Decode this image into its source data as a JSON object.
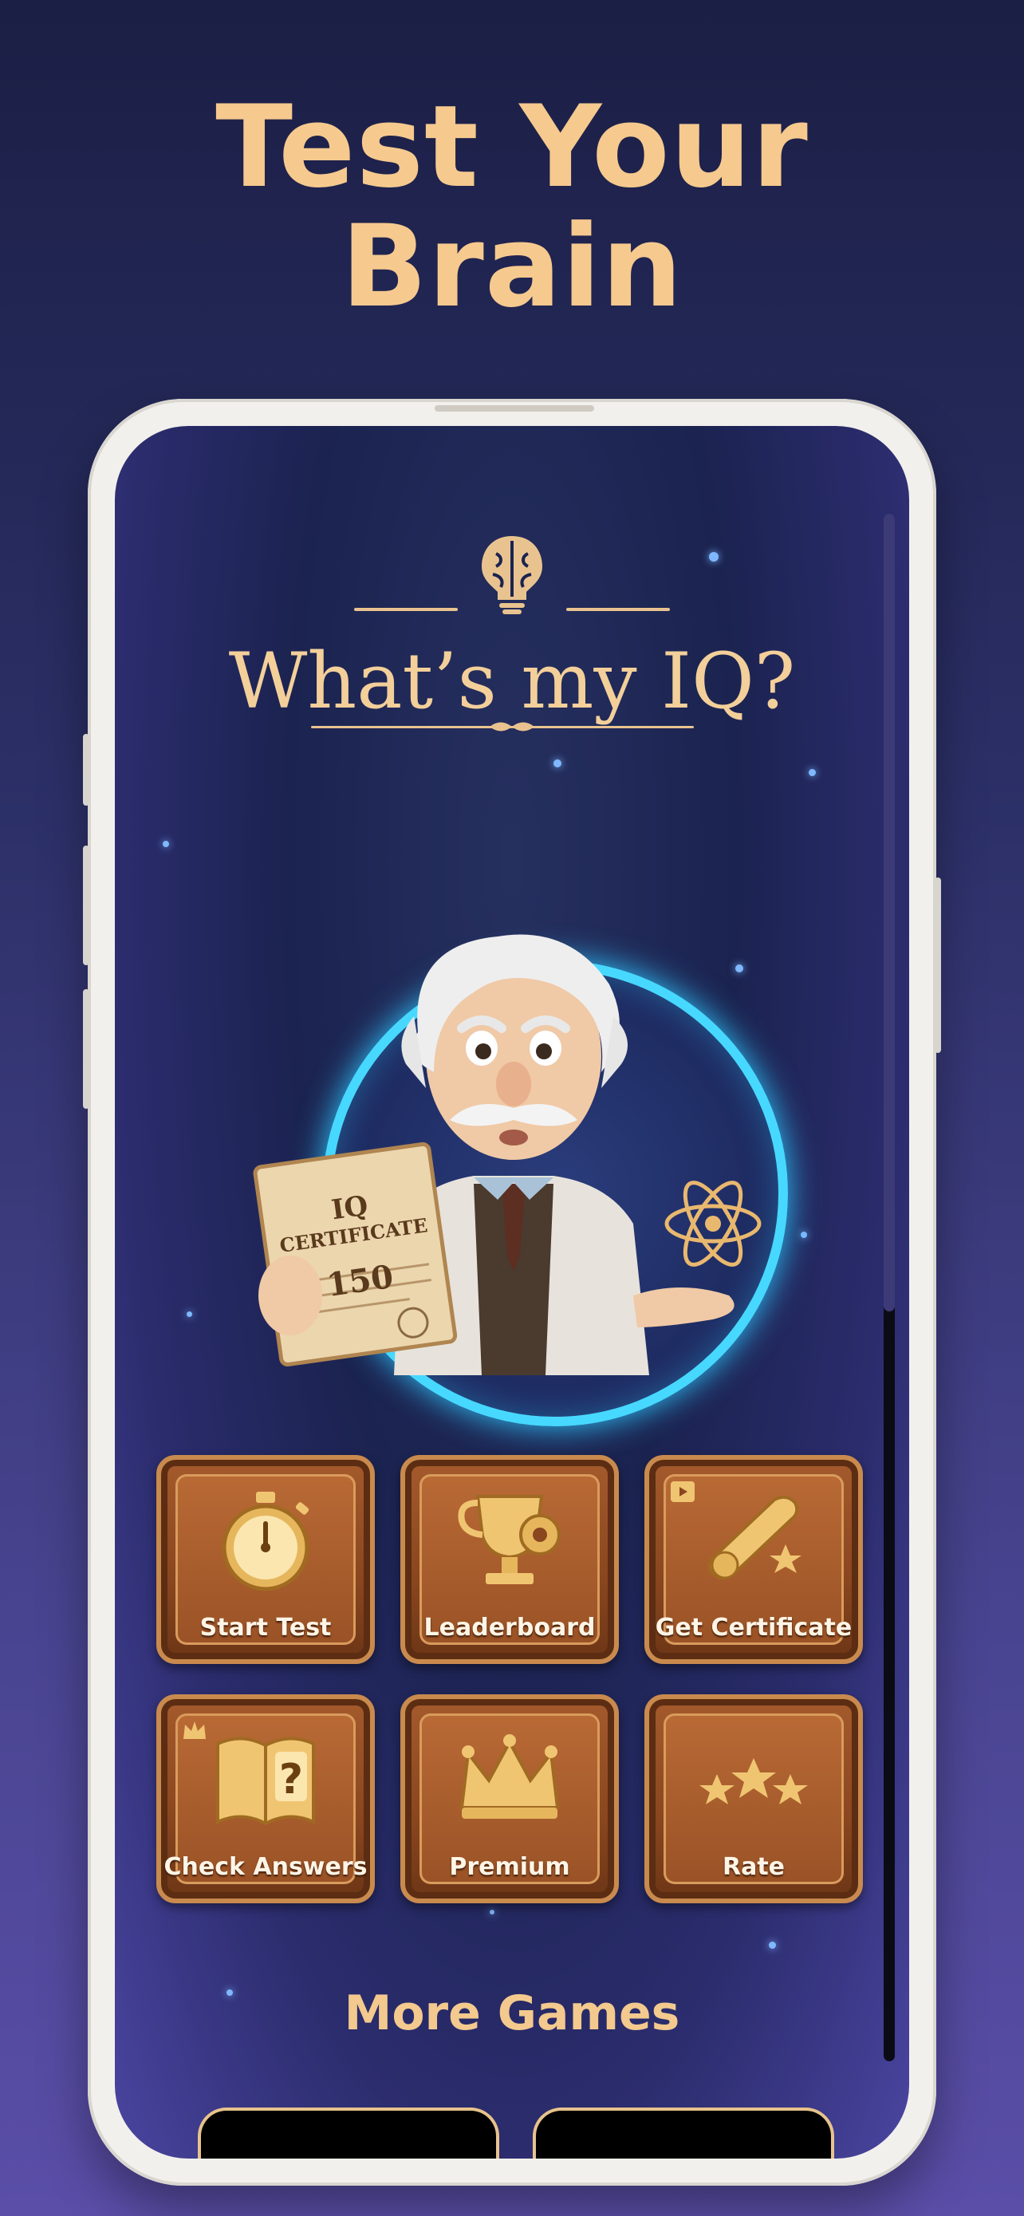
{
  "headline": {
    "line1": "Test Your",
    "line2": "Brain"
  },
  "app": {
    "title": "What’s my IQ?"
  },
  "hero": {
    "certificate_heading_1": "IQ",
    "certificate_heading_2": "CERTIFICATE",
    "certificate_score": "150"
  },
  "menu": {
    "tiles": [
      {
        "label": "Start Test",
        "icon": "stopwatch-icon"
      },
      {
        "label": "Leaderboard",
        "icon": "trophy-gear-icon"
      },
      {
        "label": "Get Certificate",
        "icon": "scroll-certificate-icon",
        "badge": "video-icon"
      },
      {
        "label": "Check Answers",
        "icon": "book-question-icon",
        "badge": "crown-icon"
      },
      {
        "label": "Premium",
        "icon": "crown-icon"
      },
      {
        "label": "Rate",
        "icon": "stars-icon"
      }
    ]
  },
  "footer": {
    "more_games": "More Games"
  },
  "colors": {
    "accent": "#f6c98e",
    "ring": "#47d8ff",
    "wood": "#9a5226"
  }
}
